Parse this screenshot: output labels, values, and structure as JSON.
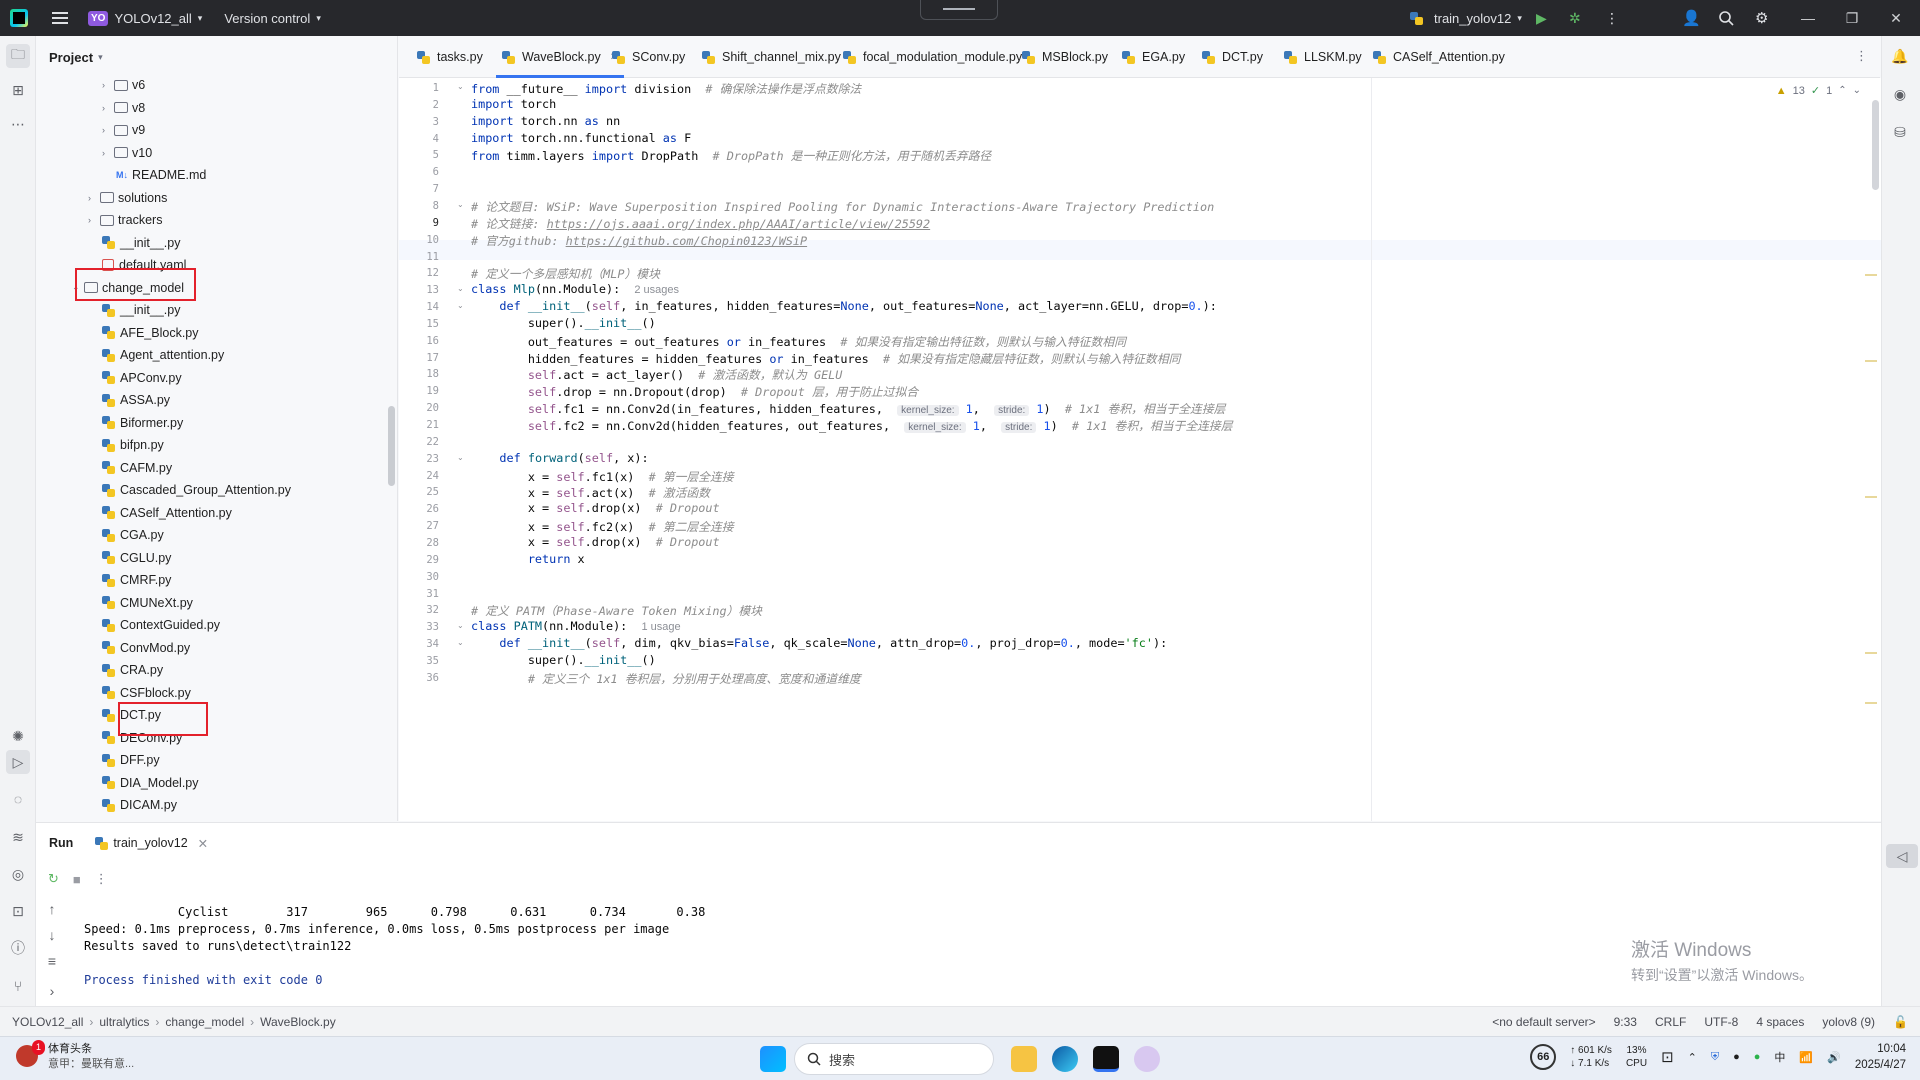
{
  "titlebar": {
    "project_badge": "YO",
    "project_name": "YOLOv12_all",
    "vcs": "Version control",
    "run_config": "train_yolov12"
  },
  "project_panel": {
    "title": "Project",
    "tree": [
      {
        "label": "v6",
        "kind": "folder",
        "depth": 3
      },
      {
        "label": "v8",
        "kind": "folder",
        "depth": 3
      },
      {
        "label": "v9",
        "kind": "folder",
        "depth": 3
      },
      {
        "label": "v10",
        "kind": "folder",
        "depth": 3
      },
      {
        "label": "README.md",
        "kind": "md",
        "depth": 3
      },
      {
        "label": "solutions",
        "kind": "folder",
        "depth": 2
      },
      {
        "label": "trackers",
        "kind": "folder",
        "depth": 2
      },
      {
        "label": "__init__.py",
        "kind": "py",
        "depth": 2
      },
      {
        "label": "default.yaml",
        "kind": "yaml",
        "depth": 2
      },
      {
        "label": "change_model",
        "kind": "folder-open",
        "depth": 1
      },
      {
        "label": "__init__.py",
        "kind": "py",
        "depth": 2
      },
      {
        "label": "AFE_Block.py",
        "kind": "py",
        "depth": 2
      },
      {
        "label": "Agent_attention.py",
        "kind": "py",
        "depth": 2
      },
      {
        "label": "APConv.py",
        "kind": "py",
        "depth": 2
      },
      {
        "label": "ASSA.py",
        "kind": "py",
        "depth": 2
      },
      {
        "label": "Biformer.py",
        "kind": "py",
        "depth": 2
      },
      {
        "label": "bifpn.py",
        "kind": "py",
        "depth": 2
      },
      {
        "label": "CAFM.py",
        "kind": "py",
        "depth": 2
      },
      {
        "label": "Cascaded_Group_Attention.py",
        "kind": "py",
        "depth": 2
      },
      {
        "label": "CASelf_Attention.py",
        "kind": "py",
        "depth": 2
      },
      {
        "label": "CGA.py",
        "kind": "py",
        "depth": 2
      },
      {
        "label": "CGLU.py",
        "kind": "py",
        "depth": 2
      },
      {
        "label": "CMRF.py",
        "kind": "py",
        "depth": 2
      },
      {
        "label": "CMUNeXt.py",
        "kind": "py",
        "depth": 2
      },
      {
        "label": "ContextGuided.py",
        "kind": "py",
        "depth": 2
      },
      {
        "label": "ConvMod.py",
        "kind": "py",
        "depth": 2
      },
      {
        "label": "CRA.py",
        "kind": "py",
        "depth": 2
      },
      {
        "label": "CSFblock.py",
        "kind": "py",
        "depth": 2
      },
      {
        "label": "DCT.py",
        "kind": "py",
        "depth": 2
      },
      {
        "label": "DEConv.py",
        "kind": "py",
        "depth": 2
      },
      {
        "label": "DFF.py",
        "kind": "py",
        "depth": 2
      },
      {
        "label": "DIA_Model.py",
        "kind": "py",
        "depth": 2
      },
      {
        "label": "DICAM.py",
        "kind": "py",
        "depth": 2
      }
    ]
  },
  "tabs": [
    {
      "label": "tasks.py",
      "active": false
    },
    {
      "label": "WaveBlock.py",
      "active": true
    },
    {
      "label": "SConv.py",
      "active": false
    },
    {
      "label": "Shift_channel_mix.py",
      "active": false
    },
    {
      "label": "focal_modulation_module.py",
      "active": false
    },
    {
      "label": "MSBlock.py",
      "active": false
    },
    {
      "label": "EGA.py",
      "active": false
    },
    {
      "label": "DCT.py",
      "active": false
    },
    {
      "label": "LLSKM.py",
      "active": false
    },
    {
      "label": "CASelf_Attention.py",
      "active": false
    }
  ],
  "editor": {
    "inspections": {
      "warnings": "13",
      "ok": "1"
    },
    "current_line": 9,
    "lines": [
      "from __future__ import division  # 确保除法操作是浮点数除法",
      "import torch",
      "import torch.nn as nn",
      "import torch.nn.functional as F",
      "from timm.layers import DropPath  # DropPath 是一种正则化方法，用于随机丢弃路径",
      "",
      "",
      "# 论文题目: WSiP: Wave Superposition Inspired Pooling for Dynamic Interactions-Aware Trajectory Prediction",
      "# 论文链接: https://ojs.aaai.org/index.php/AAAI/article/view/25592",
      "# 官方github: https://github.com/Chopin0123/WSiP",
      "",
      "# 定义一个多层感知机（MLP）模块",
      "class Mlp(nn.Module):  2 usages",
      "    def __init__(self, in_features, hidden_features=None, out_features=None, act_layer=nn.GELU, drop=0.):",
      "        super().__init__()",
      "        out_features = out_features or in_features  # 如果没有指定输出特征数，则默认与输入特征数相同",
      "        hidden_features = hidden_features or in_features  # 如果没有指定隐藏层特征数，则默认与输入特征数相同",
      "        self.act = act_layer()  # 激活函数，默认为 GELU",
      "        self.drop = nn.Dropout(drop)  # Dropout 层，用于防止过拟合",
      "        self.fc1 = nn.Conv2d(in_features, hidden_features,  kernel_size: 1,  stride: 1)  # 1x1 卷积，相当于全连接层",
      "        self.fc2 = nn.Conv2d(hidden_features, out_features,  kernel_size: 1,  stride: 1)  # 1x1 卷积，相当于全连接层",
      "",
      "    def forward(self, x):",
      "        x = self.fc1(x)  # 第一层全连接",
      "        x = self.act(x)  # 激活函数",
      "        x = self.drop(x)  # Dropout",
      "        x = self.fc2(x)  # 第二层全连接",
      "        x = self.drop(x)  # Dropout",
      "        return x",
      "",
      "",
      "# 定义 PATM（Phase-Aware Token Mixing）模块",
      "class PATM(nn.Module):  1 usage",
      "    def __init__(self, dim, qkv_bias=False, qk_scale=None, attn_drop=0., proj_drop=0., mode='fc'):",
      "        super().__init__()",
      "        # 定义三个 1x1 卷积层，分别用于处理高度、宽度和通道维度"
    ]
  },
  "run_panel": {
    "title": "Run",
    "tab": "train_yolov12",
    "output": [
      "             Cyclist        317        965      0.798      0.631      0.734       0.38",
      "Speed: 0.1ms preprocess, 0.7ms inference, 0.0ms loss, 0.5ms postprocess per image",
      "Results saved to runs\\detect\\train122",
      "",
      "Process finished with exit code 0"
    ]
  },
  "watermark": {
    "line1": "激活 Windows",
    "line2": "转到“设置”以激活 Windows。"
  },
  "statusbar": {
    "breadcrumb": [
      "YOLOv12_all",
      "ultralytics",
      "change_model",
      "WaveBlock.py"
    ],
    "server": "<no default server>",
    "position": "9:33",
    "line_sep": "CRLF",
    "encoding": "UTF-8",
    "indent": "4 spaces",
    "interpreter": "yolov8 (9)"
  },
  "taskbar": {
    "news_title": "体育头条",
    "news_sub": "意甲：曼联有意...",
    "news_badge": "1",
    "search_placeholder": "搜索",
    "battery": "66",
    "net_up": "↑ 601 K/s",
    "net_down": "↓ 7.1 K/s",
    "cpu_pct": "13%",
    "cpu_label": "CPU",
    "ime": "中",
    "time": "10:04",
    "date": "2025/4/27"
  }
}
